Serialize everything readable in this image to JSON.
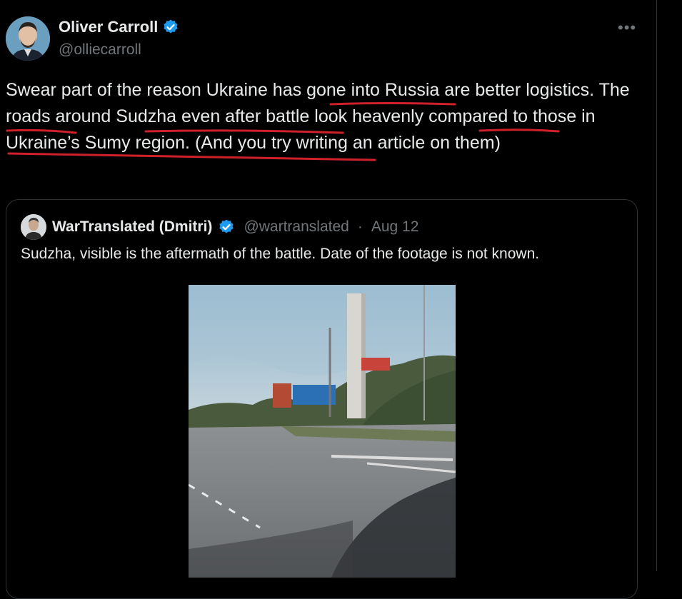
{
  "tweet": {
    "author_name": "Oliver Carroll",
    "author_handle": "@olliecarroll",
    "more_label": "•••",
    "text_parts": [
      "Swear part of the reason Ukraine has ",
      "gone into Russia",
      " are better ",
      "logistics",
      ". The ",
      "roads around Sudzha even",
      " after battle ",
      "look heavenly",
      " ",
      "compared to those in Ukraine’s Sumy region",
      ". (And you try writing an article on them)"
    ]
  },
  "quote": {
    "author_name": "WarTranslated (Dmitri)",
    "author_handle": "@wartranslated",
    "separator": "·",
    "date": "Aug 12",
    "text": "Sudzha, visible is the aftermath of the battle. Date of the footage is not known."
  },
  "colors": {
    "background": "#000000",
    "text": "#e7e9ea",
    "secondary": "#71767b",
    "verified": "#1d9bf0",
    "underline": "#d0202a"
  }
}
